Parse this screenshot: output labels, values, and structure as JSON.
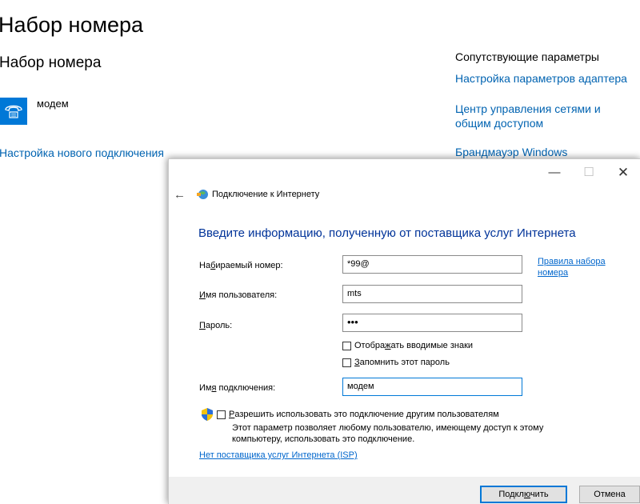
{
  "settings": {
    "title": "Набор номера",
    "section_title": "Набор номера",
    "connection_name": "модем",
    "new_connection_link": "Настройка нового подключения",
    "related": {
      "title": "Сопутствующие параметры",
      "links": [
        "Настройка параметров адаптера",
        "Центр управления сетями и общим доступом",
        "Брандмауэр Windows"
      ]
    }
  },
  "dialog": {
    "title": "Подключение к Интернету",
    "heading": "Введите информацию, полученную от поставщика услуг Интернета",
    "fields": {
      "phone": {
        "label_pre": "На",
        "label_acc": "б",
        "label_post": "ираемый номер:",
        "value": "*99@"
      },
      "username": {
        "label_pre": "",
        "label_acc": "И",
        "label_post": "мя пользователя:",
        "value": "mts"
      },
      "password": {
        "label_pre": "",
        "label_acc": "П",
        "label_post": "ароль:",
        "value": "•••"
      },
      "connection_name": {
        "label_pre": "Им",
        "label_acc": "я",
        "label_post": " подключения:",
        "value": "модем"
      }
    },
    "dial_rules_link": {
      "line1": "Правила набора",
      "line2": "номера"
    },
    "show_chars": {
      "pre": "Отобра",
      "acc": "ж",
      "post": "ать вводимые знаки",
      "checked": false
    },
    "remember_password": {
      "pre": "",
      "acc": "З",
      "post": "апомнить этот пароль",
      "checked": false
    },
    "allow_others": {
      "pre": "",
      "acc": "Р",
      "post": "азрешить использовать это подключение другим пользователям",
      "checked": false
    },
    "allow_desc": "Этот параметр позволяет любому пользователю, имеющему доступ к этому компьютеру, использовать это подключение.",
    "no_isp_link": "Нет поставщика услуг Интернета (ISP)",
    "buttons": {
      "connect": {
        "pre": "Подкл",
        "acc": "ю",
        "post": "чить"
      },
      "cancel": "Отмена"
    },
    "window_buttons": {
      "minimize": "—",
      "maximize": "☐",
      "close": "✕"
    },
    "back_arrow": "←"
  },
  "colors": {
    "accent": "#0078d7",
    "link": "#0063b1",
    "heading": "#003399"
  }
}
